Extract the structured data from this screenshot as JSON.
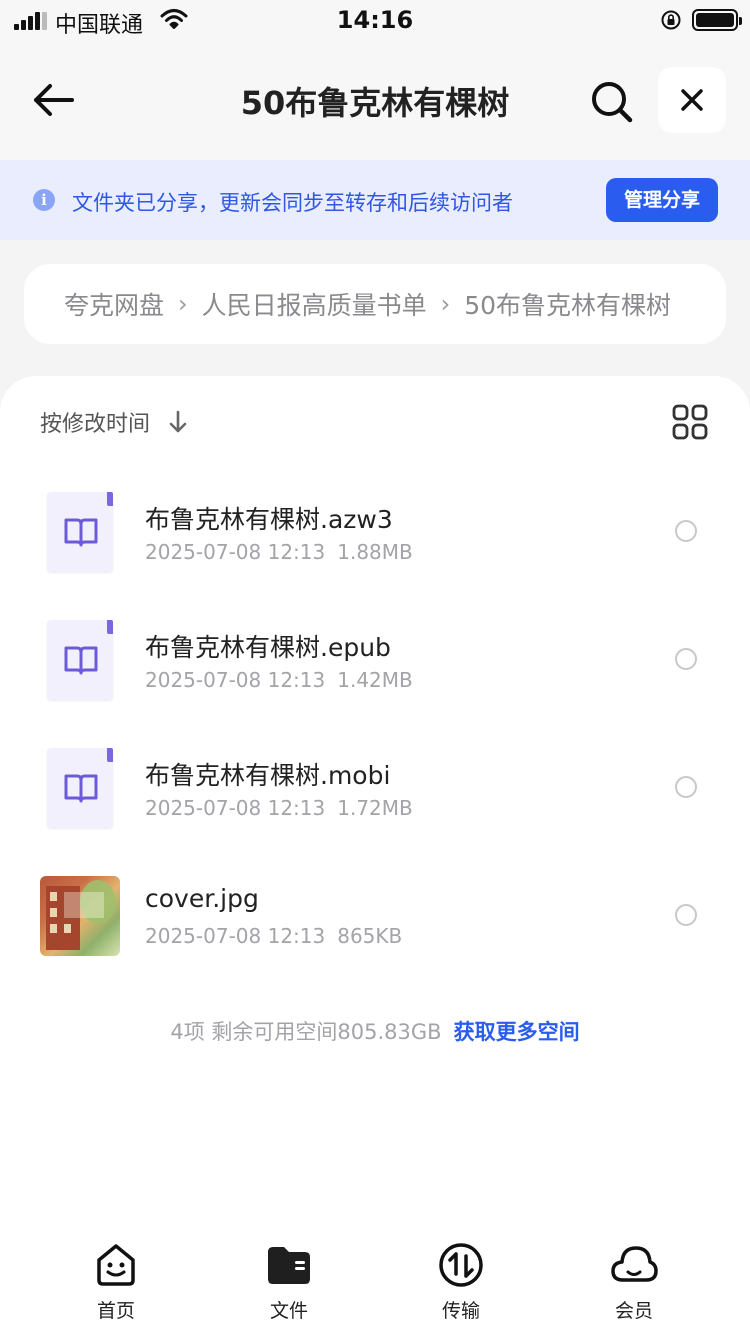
{
  "status_bar": {
    "carrier": "中国联通",
    "time": "14:16"
  },
  "header": {
    "title": "50布鲁克林有棵树",
    "back_icon": "arrow-left-icon",
    "search_icon": "search-icon",
    "close_icon": "close-icon"
  },
  "banner": {
    "text": "文件夹已分享，更新会同步至转存和后续访问者",
    "button": "管理分享",
    "info_glyph": "i"
  },
  "breadcrumb": [
    "夸克网盘",
    "人民日报高质量书单",
    "50布鲁克林有棵树"
  ],
  "breadcrumb_separator": "›",
  "sort": {
    "label": "按修改时间"
  },
  "files": [
    {
      "name": "布鲁克林有棵树.azw3",
      "date": "2025-07-08 12:13",
      "size": "1.88MB",
      "type": "ebook"
    },
    {
      "name": "布鲁克林有棵树.epub",
      "date": "2025-07-08 12:13",
      "size": "1.42MB",
      "type": "ebook"
    },
    {
      "name": "布鲁克林有棵树.mobi",
      "date": "2025-07-08 12:13",
      "size": "1.72MB",
      "type": "ebook"
    },
    {
      "name": "cover.jpg",
      "date": "2025-07-08 12:13",
      "size": "865KB",
      "type": "image"
    }
  ],
  "footer": {
    "info": "4项 剩余可用空间805.83GB",
    "link": "获取更多空间"
  },
  "tabbar": [
    {
      "label": "首页",
      "icon": "smiley-home-icon"
    },
    {
      "label": "文件",
      "icon": "folder-icon"
    },
    {
      "label": "传输",
      "icon": "transfer-icon"
    },
    {
      "label": "会员",
      "icon": "cloud-icon"
    }
  ],
  "colors": {
    "accent": "#2b5cf0",
    "banner_bg": "#eaedfd",
    "ebook_mark": "#7b67e0"
  }
}
